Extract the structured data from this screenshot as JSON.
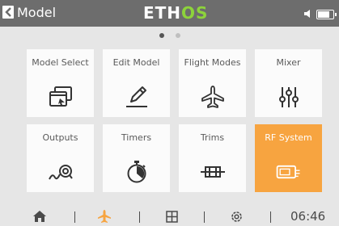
{
  "header": {
    "title": "Model",
    "logo_main": "ETH",
    "logo_accent": "OS",
    "battery_level": 0.85,
    "back_icon": "chevron-left-icon",
    "speaker_icon": "speaker-icon",
    "battery_icon": "battery-icon"
  },
  "pager": {
    "pages": 2,
    "active_page": 1
  },
  "tiles": [
    {
      "label": "Model Select",
      "icon": "model-select-icon"
    },
    {
      "label": "Edit Model",
      "icon": "pencil-icon"
    },
    {
      "label": "Flight Modes",
      "icon": "airplane-icon"
    },
    {
      "label": "Mixer",
      "icon": "sliders-icon"
    },
    {
      "label": "Outputs",
      "icon": "outputs-icon"
    },
    {
      "label": "Timers",
      "icon": "stopwatch-icon"
    },
    {
      "label": "Trims",
      "icon": "trims-icon"
    },
    {
      "label": "RF System",
      "icon": "rf-module-icon",
      "selected": true
    }
  ],
  "footer": {
    "time": "06:46",
    "icons": [
      "home-icon",
      "model-icon",
      "grid-icon",
      "settings-icon"
    ]
  },
  "colors": {
    "accent": "#f7a440",
    "header_bg": "#6d6d6d",
    "logo_accent": "#8dd33b",
    "background": "#e6e6e6",
    "tile_bg": "#fbfbfb"
  }
}
